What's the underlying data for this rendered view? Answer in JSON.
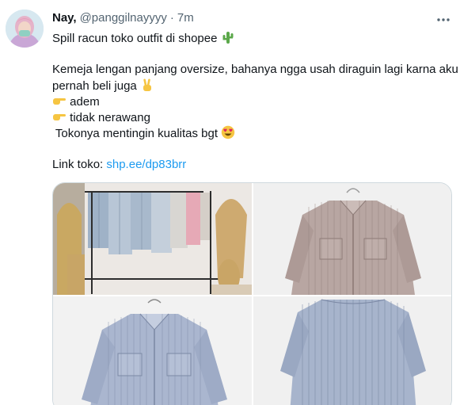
{
  "tweet": {
    "author_name": "Nay,",
    "author_handle": "@panggilnayyyy",
    "separator": "·",
    "timestamp": "7m",
    "lines": [
      "Spill racun toko outfit di shopee",
      "",
      "Kemeja lengan panjang oversize, bahanya ngga usah diraguin lagi karna aku",
      "pernah beli juga",
      "adem",
      "tidak nerawang",
      " Tokonya mentingin kualitas bgt"
    ],
    "link_label": "Link toko: ",
    "link_text": "shp.ee/dp83brr",
    "emojis": [
      "cactus",
      "victory-hand",
      "pointing-right",
      "pointing-right",
      "heart-eyes"
    ]
  },
  "media": {
    "photo_count": 4,
    "photos": [
      "clothing-rack-shirts",
      "brown-striped-shirt",
      "blue-striped-shirt-front",
      "blue-striped-shirt-back"
    ]
  },
  "icons": {
    "more": "more-horizontal-icon"
  },
  "colors": {
    "link": "#1d9bf0",
    "secondary_text": "#536471",
    "border": "#cfd9de"
  }
}
